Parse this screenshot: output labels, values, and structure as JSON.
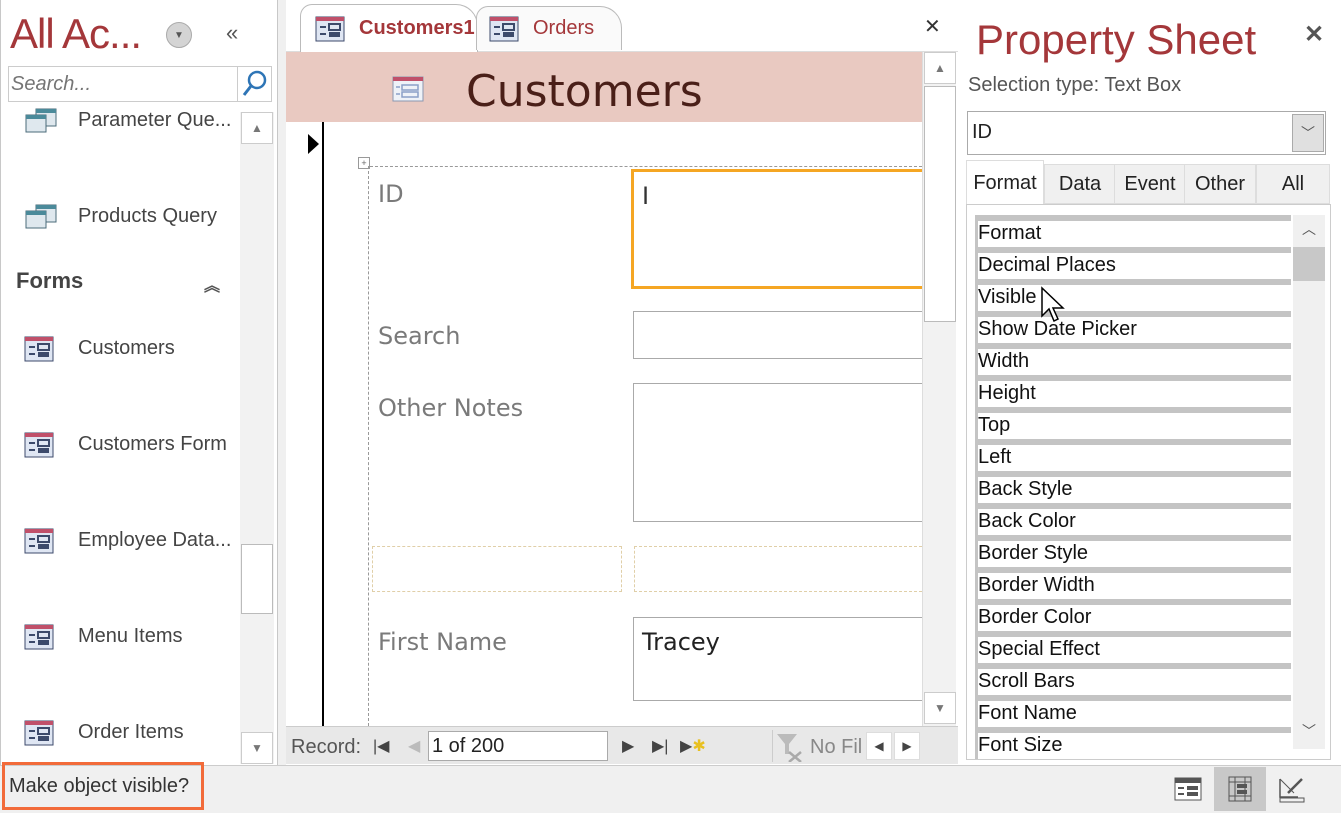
{
  "nav_pane": {
    "title": "All Ac...",
    "search_placeholder": "Search...",
    "items_before": [
      {
        "label": "Parameter Que...",
        "icon": "query-icon"
      },
      {
        "label": "Products Query",
        "icon": "query-icon"
      }
    ],
    "group": {
      "label": "Forms",
      "collapse_glyph": "⌃"
    },
    "forms": [
      {
        "label": "Customers"
      },
      {
        "label": "Customers Form"
      },
      {
        "label": "Employee Data..."
      },
      {
        "label": "Menu Items"
      },
      {
        "label": "Order Items"
      }
    ]
  },
  "tabs": [
    {
      "label": "Customers1",
      "active": true
    },
    {
      "label": "Orders",
      "active": false
    }
  ],
  "form": {
    "header_title": "Customers",
    "fields": [
      {
        "label": "ID",
        "value": "I"
      },
      {
        "label": "Search",
        "value": ""
      },
      {
        "label": "Other Notes",
        "value": ""
      },
      {
        "label": "First Name",
        "value": "Tracey"
      }
    ],
    "selected_field_color": "#f5a623"
  },
  "record_nav": {
    "label": "Record:",
    "position": "1 of 200",
    "filter_label": "No Fil"
  },
  "property_sheet": {
    "title": "Property Sheet",
    "selection_type": "Selection type: Text Box",
    "selected_object": "ID",
    "tabs": [
      "Format",
      "Data",
      "Event",
      "Other",
      "All"
    ],
    "active_tab": "Format",
    "properties": [
      "Format",
      "Decimal Places",
      "Visible",
      "Show Date Picker",
      "Width",
      "Height",
      "Top",
      "Left",
      "Back Style",
      "Back Color",
      "Border Style",
      "Border Width",
      "Border Color",
      "Special Effect",
      "Scroll Bars",
      "Font Name",
      "Font Size"
    ]
  },
  "status_bar": {
    "text": "Make object visible?",
    "highlight_color": "#f26b3a",
    "views": [
      "form-view",
      "layout-view",
      "design-view"
    ],
    "active_view": "layout-view"
  },
  "colors": {
    "accent": "#a4373a",
    "header_bg": "#e9c9c1"
  }
}
